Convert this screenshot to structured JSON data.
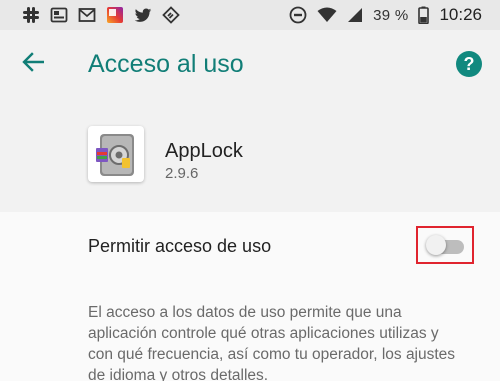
{
  "status_bar": {
    "notification_icons": [
      "slack-icon",
      "photo-icon",
      "gmail-icon",
      "app-icon",
      "twitter-icon",
      "feedly-icon"
    ],
    "system_icons": [
      "do-not-disturb-icon",
      "wifi-icon",
      "signal-icon",
      "battery-icon"
    ],
    "battery_percent": "39 %",
    "time": "10:26"
  },
  "app_bar": {
    "title": "Acceso al uso",
    "back_icon": "arrow-back-icon",
    "help_icon": "help-icon",
    "help_glyph": "?"
  },
  "app_info": {
    "name": "AppLock",
    "version": "2.9.6",
    "icon": "applock-icon"
  },
  "permission": {
    "label": "Permitir acceso de uso",
    "enabled": false,
    "description": "El acceso a los datos de uso permite que una aplicación controle qué otras aplicaciones utilizas y con qué frecuencia, así como tu operador, los ajustes de idioma y otros detalles."
  },
  "colors": {
    "accent": "#117e77",
    "highlight": "#e0242e",
    "background": "#f2f2f2",
    "surface": "#fafafa"
  }
}
